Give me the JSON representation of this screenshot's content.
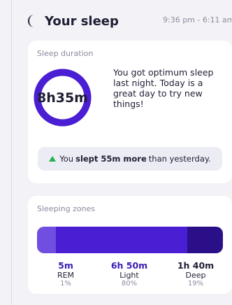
{
  "header": {
    "title": "Your sleep",
    "time_range": "9:36 pm - 6:11 am"
  },
  "duration_card": {
    "title": "Sleep duration",
    "total": "8h35m",
    "ring_fraction": 1.0,
    "message": "You got optimum sleep last night. Today is a great day to try new things!",
    "comparison": {
      "prefix": "You",
      "highlight": "slept 55m more",
      "suffix": "than yesterday."
    }
  },
  "zones_card": {
    "title": "Sleeping zones",
    "zones": [
      {
        "duration": "5m",
        "name": "REM",
        "percent": "1%",
        "fraction": 0.1
      },
      {
        "duration": "6h 50m",
        "name": "Light",
        "percent": "80%",
        "fraction": 0.71
      },
      {
        "duration": "1h 40m",
        "name": "Deep",
        "percent": "19%",
        "fraction": 0.19
      }
    ]
  },
  "colors": {
    "accent": "#4a1ed3",
    "accent_light": "#6f4ee0",
    "accent_dark": "#2b0f89",
    "positive": "#21b04b",
    "background": "#f3f3f7"
  },
  "icons": {
    "moon": "moon-icon",
    "trend": "triangle-up-icon"
  }
}
